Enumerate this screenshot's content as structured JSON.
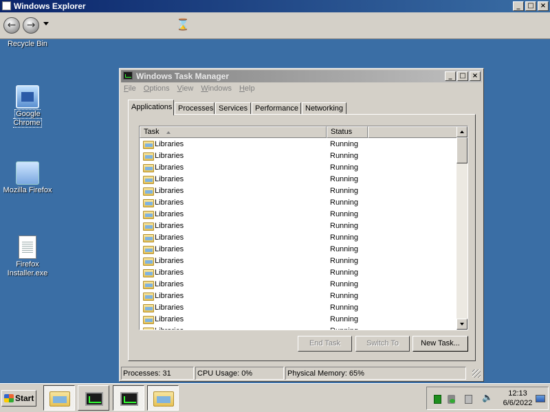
{
  "explorer": {
    "title": "Windows Explorer",
    "controls": {
      "minimize": "_",
      "maximize": "□",
      "close": "×"
    },
    "toolbar": {
      "back_glyph": "←",
      "forward_glyph": "→",
      "cursor_glyph": "⌛"
    }
  },
  "desktop": {
    "icons": [
      {
        "label": "Recycle Bin",
        "icon": "recycle-bin-icon"
      },
      {
        "label": "Google Chrome",
        "icon": "monitor-shortcut-icon"
      },
      {
        "label": "Mozilla Firefox",
        "icon": "music-shortcut-icon"
      },
      {
        "label": "Firefox Installer.exe",
        "label_line1": "Firefox",
        "label_line2": "Installer.exe",
        "icon": "document-icon"
      }
    ]
  },
  "task_manager": {
    "title": "Windows Task Manager",
    "controls": {
      "minimize": "_",
      "maximize": "□",
      "close": "×"
    },
    "menu": {
      "file": {
        "acc": "F",
        "rest": "ile"
      },
      "options": {
        "acc": "O",
        "rest": "ptions"
      },
      "view": {
        "acc": "V",
        "rest": "iew"
      },
      "windows": {
        "acc": "W",
        "rest": "indows"
      },
      "help": {
        "acc": "H",
        "rest": "elp"
      }
    },
    "tabs": {
      "applications": "Applications",
      "processes": "Processes",
      "services": "Services",
      "performance": "Performance",
      "networking": "Networking"
    },
    "active_tab": "Applications",
    "list": {
      "columns": {
        "task": "Task",
        "status": "Status",
        "blank": ""
      },
      "rows": [
        {
          "task": "Libraries",
          "status": "Running"
        },
        {
          "task": "Libraries",
          "status": "Running"
        },
        {
          "task": "Libraries",
          "status": "Running"
        },
        {
          "task": "Libraries",
          "status": "Running"
        },
        {
          "task": "Libraries",
          "status": "Running"
        },
        {
          "task": "Libraries",
          "status": "Running"
        },
        {
          "task": "Libraries",
          "status": "Running"
        },
        {
          "task": "Libraries",
          "status": "Running"
        },
        {
          "task": "Libraries",
          "status": "Running"
        },
        {
          "task": "Libraries",
          "status": "Running"
        },
        {
          "task": "Libraries",
          "status": "Running"
        },
        {
          "task": "Libraries",
          "status": "Running"
        },
        {
          "task": "Libraries",
          "status": "Running"
        },
        {
          "task": "Libraries",
          "status": "Running"
        },
        {
          "task": "Libraries",
          "status": "Running"
        },
        {
          "task": "Libraries",
          "status": "Running"
        },
        {
          "task": "Libraries",
          "status": "Running"
        }
      ]
    },
    "buttons": {
      "end_task": "End Task",
      "switch_to": "Switch To",
      "new_task": "New Task..."
    },
    "status": {
      "processes": "Processes: 31",
      "cpu": "CPU Usage: 0%",
      "memory": "Physical Memory: 65%"
    }
  },
  "taskbar": {
    "start_label": "Start",
    "buttons": [
      "explorer-folder-icon",
      "task-manager-icon",
      "task-manager-icon",
      "explorer-folder-icon"
    ],
    "clock": {
      "time": "12:13",
      "date": "6/6/2022"
    },
    "tray_icons": [
      "green-square-icon",
      "network-icon",
      "computer-icon",
      "volume-icon",
      "show-desktop-icon"
    ],
    "volume_glyph": "🔈"
  }
}
